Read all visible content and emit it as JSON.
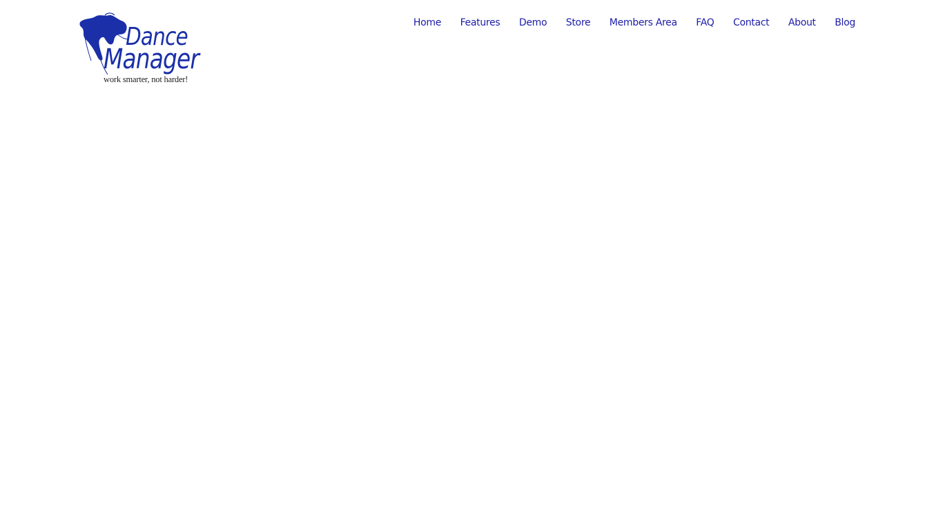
{
  "brand": {
    "name_line1": "Dance",
    "name_line2": "Manager",
    "tagline": "work smarter, not harder!",
    "logo_icon": "dancer-silhouette-icon",
    "color": "#1a2fa8"
  },
  "nav": {
    "color": "#1c1ca8",
    "items": [
      {
        "label": "Home"
      },
      {
        "label": "Features"
      },
      {
        "label": "Demo"
      },
      {
        "label": "Store"
      },
      {
        "label": "Members Area"
      },
      {
        "label": "FAQ"
      },
      {
        "label": "Contact"
      },
      {
        "label": "About"
      },
      {
        "label": "Blog"
      }
    ]
  }
}
